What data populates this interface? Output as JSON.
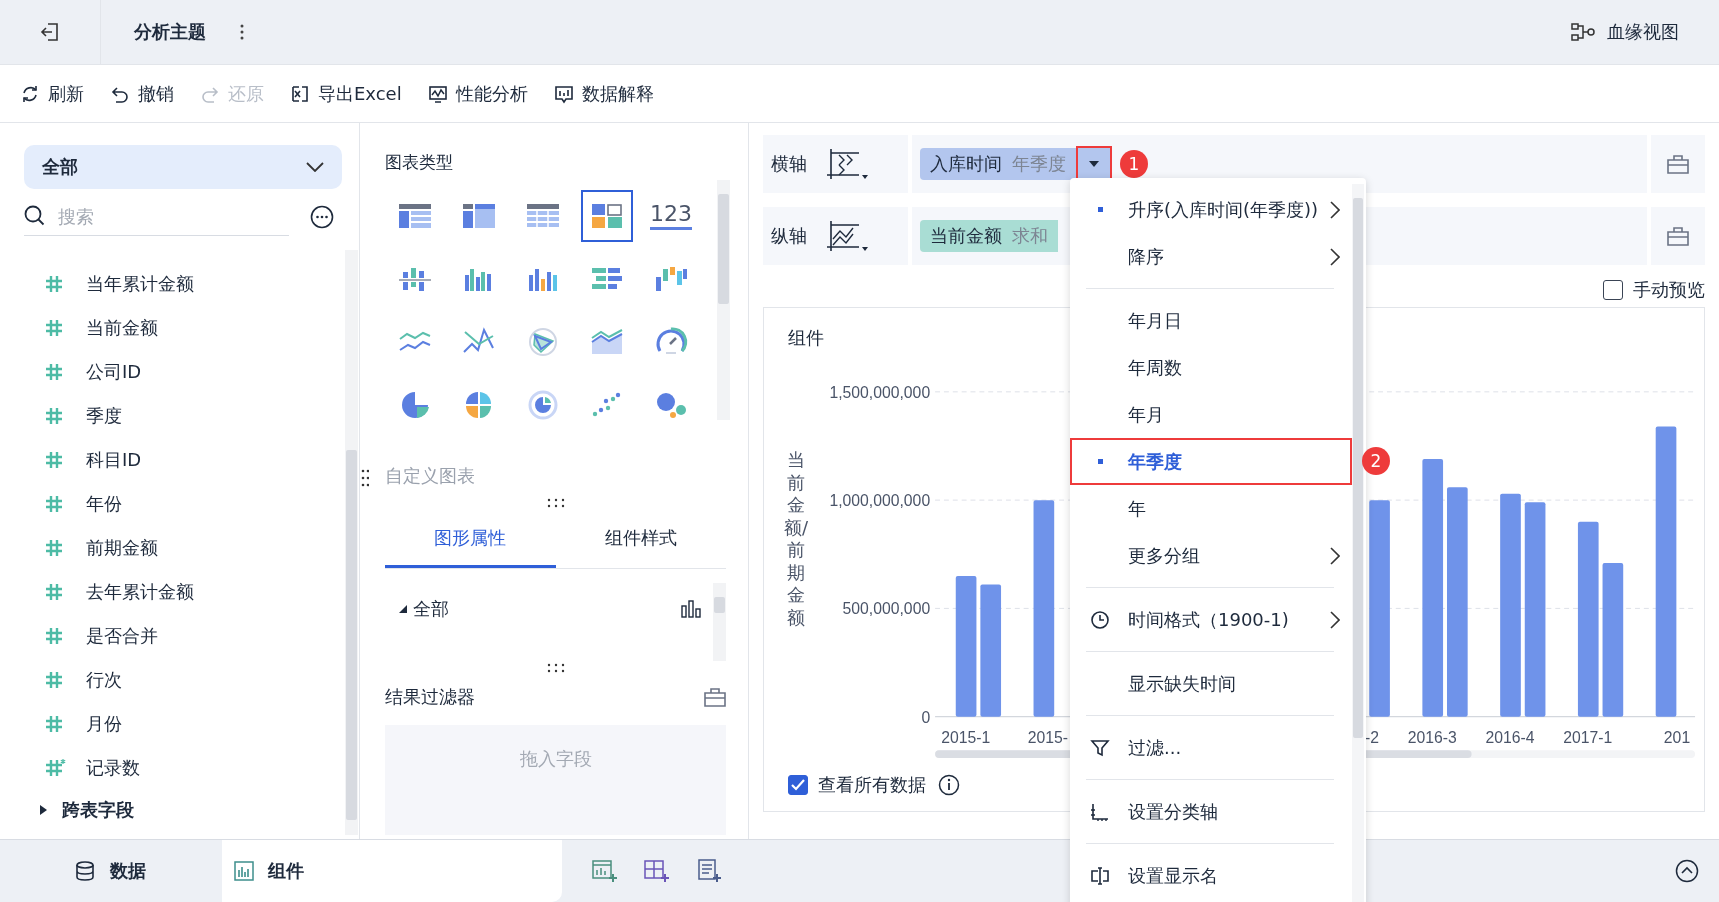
{
  "header": {
    "title": "分析主题",
    "lineage": "血缘视图"
  },
  "toolbar": [
    {
      "kind": "refresh",
      "label": "刷新",
      "disabled": false
    },
    {
      "kind": "undo",
      "label": "撤销",
      "disabled": false
    },
    {
      "kind": "redo",
      "label": "还原",
      "disabled": true
    },
    {
      "kind": "export",
      "label": "导出Excel",
      "disabled": false
    },
    {
      "kind": "performance",
      "label": "性能分析",
      "disabled": false
    },
    {
      "kind": "explain",
      "label": "数据解释",
      "disabled": false
    }
  ],
  "data_panel": {
    "scope": "全部",
    "search": {
      "placeholder": "搜索"
    },
    "fields": [
      {
        "name": "当年累计金额",
        "kind": "number"
      },
      {
        "name": "当前金额",
        "kind": "number"
      },
      {
        "name": "公司ID",
        "kind": "number"
      },
      {
        "name": "季度",
        "kind": "number"
      },
      {
        "name": "科目ID",
        "kind": "number"
      },
      {
        "name": "年份",
        "kind": "number"
      },
      {
        "name": "前期金额",
        "kind": "number"
      },
      {
        "name": "去年累计金额",
        "kind": "number"
      },
      {
        "name": "是否合并",
        "kind": "number"
      },
      {
        "name": "行次",
        "kind": "number"
      },
      {
        "name": "月份",
        "kind": "number"
      },
      {
        "name": "记录数",
        "kind": "count"
      }
    ],
    "groups": [
      {
        "label": "跨表字段",
        "expanded": false
      }
    ]
  },
  "chart_types": {
    "title": "图表类型",
    "custom": "自定义图表",
    "items": [
      {
        "selected": false
      },
      {
        "selected": false
      },
      {
        "selected": false
      },
      {
        "selected": true
      },
      {
        "selected": false,
        "glyph": "123"
      },
      {
        "selected": false
      },
      {
        "selected": false
      },
      {
        "selected": false
      },
      {
        "selected": false
      },
      {
        "selected": false
      },
      {
        "selected": false
      },
      {
        "selected": false
      },
      {
        "selected": false
      },
      {
        "selected": false
      },
      {
        "selected": false
      },
      {
        "selected": false
      },
      {
        "selected": false
      },
      {
        "selected": false
      },
      {
        "selected": false
      },
      {
        "selected": false
      }
    ]
  },
  "property_tabs": [
    {
      "label": "图形属性",
      "selected": true
    },
    {
      "label": "组件样式",
      "selected": false
    }
  ],
  "property_tree": [
    {
      "label": "全部",
      "expanded": true
    }
  ],
  "result_filter": {
    "title": "结果过滤器",
    "placeholder": "拖入字段"
  },
  "axes": [
    {
      "label": "横轴",
      "kind": "x",
      "field": "入库时间",
      "aggregation": "年季度",
      "color": "#b3c6ee",
      "callout": "1"
    },
    {
      "label": "纵轴",
      "kind": "y",
      "field": "当前金额",
      "aggregation": "求和",
      "color": "#a9ddd4"
    }
  ],
  "manual_preview": {
    "label": "手动预览",
    "checked": false
  },
  "widget": {
    "title": "组件",
    "show_all": {
      "label": "查看所有数据",
      "checked": true
    },
    "chart_data": {
      "type": "bar",
      "ylabel": "当前金额/前期金额",
      "categories": [
        "2015-1",
        "2015-",
        null,
        null,
        null,
        "-2",
        "2016-3",
        "2016-4",
        "2017-1",
        "201"
      ],
      "series": [
        {
          "color": "#6f93ea",
          "values": [
            650000000,
            1000000000,
            null,
            null,
            null,
            null,
            1190000000,
            1030000000,
            900000000,
            1340000000
          ]
        },
        {
          "color": "#6f93ea",
          "values": [
            610000000,
            null,
            null,
            null,
            null,
            1000000000,
            1060000000,
            990000000,
            710000000,
            null
          ]
        }
      ],
      "ylim": [
        0,
        1500000000
      ],
      "yticks": [
        {
          "value": 0,
          "label": "0"
        },
        {
          "value": 500000000,
          "label": "500,000,000"
        },
        {
          "value": 1000000000,
          "label": "1,000,000,000"
        },
        {
          "value": 1500000000,
          "label": "1,500,000,000"
        }
      ]
    }
  },
  "menu": {
    "sections": [
      [
        {
          "label": "升序(入库时间(年季度))",
          "kind": "plain",
          "checked": true,
          "selected": false,
          "submenu": true
        },
        {
          "label": "降序",
          "kind": "plain",
          "checked": false,
          "selected": false,
          "submenu": true
        }
      ],
      [
        {
          "label": "年月日",
          "kind": "plain",
          "checked": false,
          "selected": false,
          "submenu": false
        },
        {
          "label": "年周数",
          "kind": "plain",
          "checked": false,
          "selected": false,
          "submenu": false
        },
        {
          "label": "年月",
          "kind": "plain",
          "checked": false,
          "selected": false,
          "submenu": false
        },
        {
          "label": "年季度",
          "kind": "plain",
          "checked": true,
          "selected": true,
          "submenu": false,
          "callout": "2"
        },
        {
          "label": "年",
          "kind": "plain",
          "checked": false,
          "selected": false,
          "submenu": false
        },
        {
          "label": "更多分组",
          "kind": "plain",
          "checked": false,
          "selected": false,
          "submenu": true
        }
      ],
      [
        {
          "label": "时间格式（1900-1)",
          "kind": "time",
          "checked": false,
          "selected": false,
          "submenu": true
        }
      ],
      [
        {
          "label": "显示缺失时间",
          "kind": "plain",
          "checked": false,
          "selected": false,
          "submenu": false
        }
      ],
      [
        {
          "label": "过滤...",
          "kind": "filter",
          "checked": false,
          "selected": false,
          "submenu": false
        }
      ],
      [
        {
          "label": "设置分类轴",
          "kind": "axis",
          "checked": false,
          "selected": false,
          "submenu": false
        }
      ],
      [
        {
          "label": "设置显示名",
          "kind": "rename",
          "checked": false,
          "selected": false,
          "submenu": false
        }
      ]
    ]
  },
  "bottom_tabs": [
    {
      "label": "数据",
      "kind": "data",
      "selected": false
    },
    {
      "label": "组件",
      "kind": "widget",
      "selected": true
    }
  ]
}
